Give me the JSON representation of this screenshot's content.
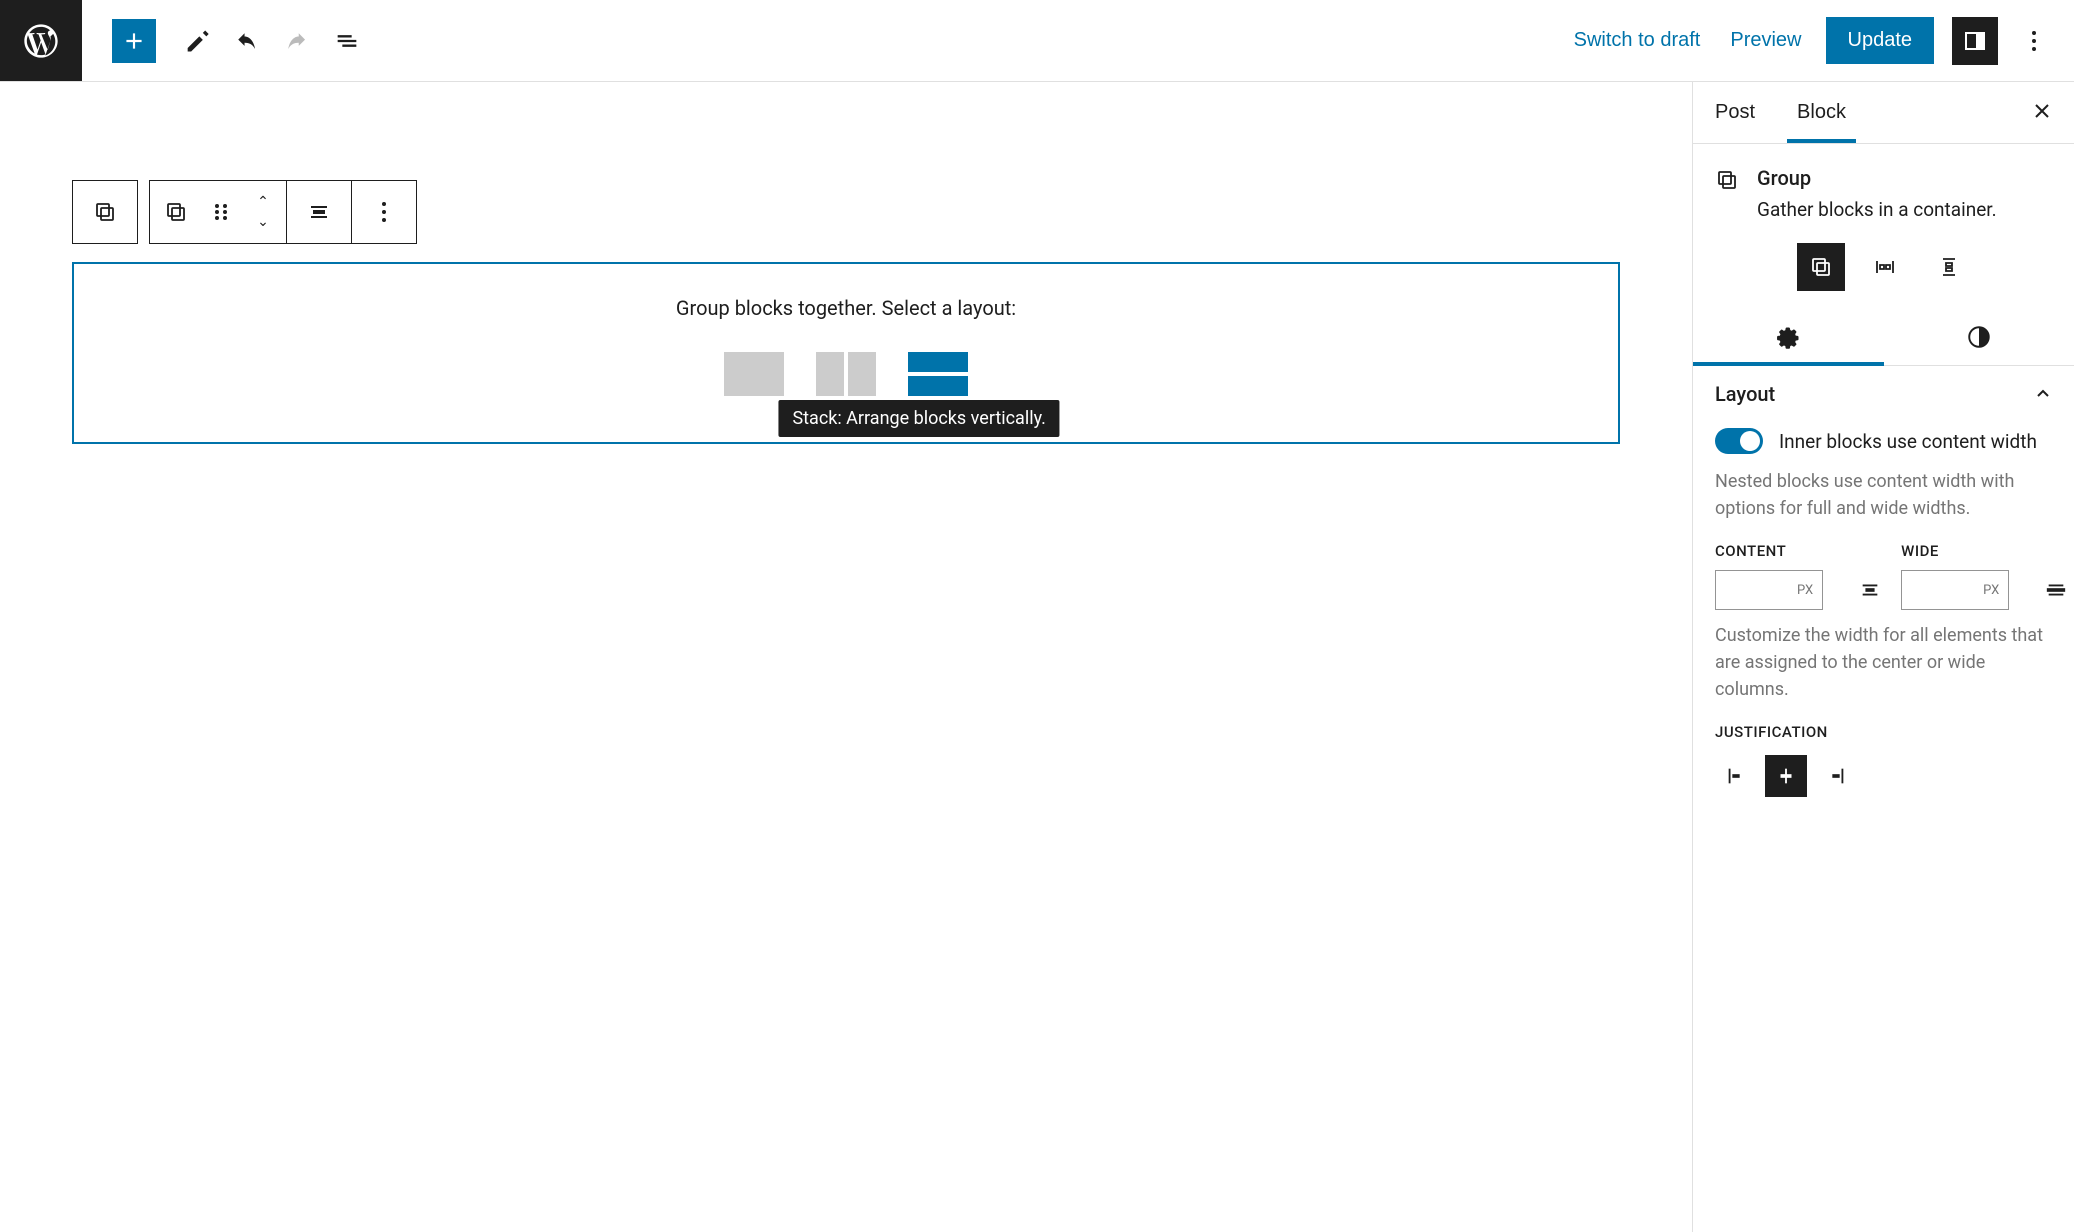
{
  "header": {
    "switch_to_draft": "Switch to draft",
    "preview": "Preview",
    "update": "Update"
  },
  "editor": {
    "group_placeholder_label": "Group blocks together. Select a layout:",
    "tooltip_stack": "Stack: Arrange blocks vertically."
  },
  "sidebar": {
    "tabs": {
      "post": "Post",
      "block": "Block"
    },
    "block_info": {
      "title": "Group",
      "description": "Gather blocks in a container."
    },
    "layout": {
      "title": "Layout",
      "toggle_label": "Inner blocks use content width",
      "toggle_help": "Nested blocks use content width with options for full and wide widths.",
      "content_label": "CONTENT",
      "wide_label": "WIDE",
      "px_unit": "PX",
      "width_help": "Customize the width for all elements that are assigned to the center or wide columns.",
      "justification_label": "JUSTIFICATION"
    }
  }
}
